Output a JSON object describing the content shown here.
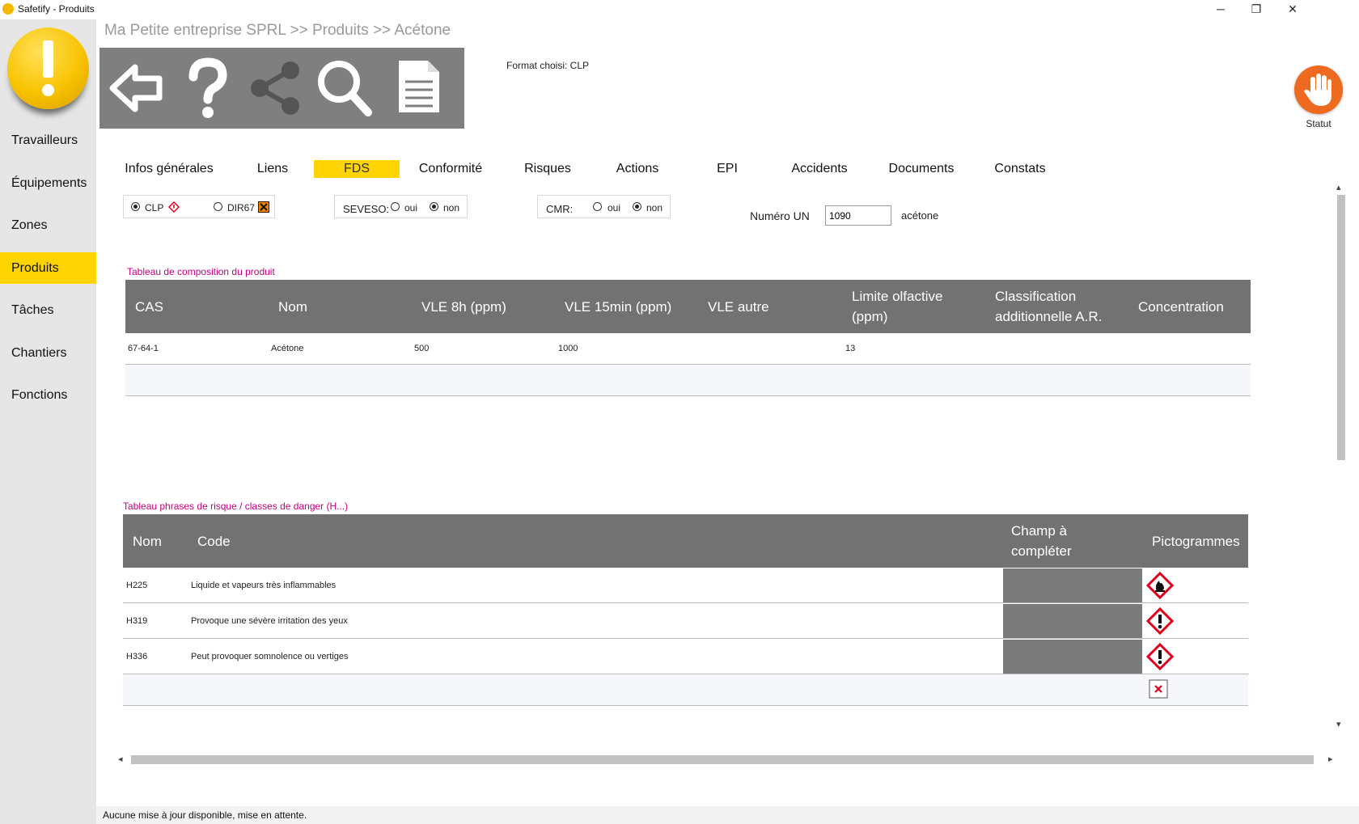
{
  "window": {
    "title": "Safetify - Produits",
    "minimize": "─",
    "maximize": "❐",
    "close": "✕"
  },
  "sidebar": {
    "items": [
      {
        "label": "Travailleurs"
      },
      {
        "label": "Équipements"
      },
      {
        "label": "Zones"
      },
      {
        "label": "Produits",
        "active": true
      },
      {
        "label": "Tâches"
      },
      {
        "label": "Chantiers"
      },
      {
        "label": "Fonctions"
      }
    ]
  },
  "breadcrumb": "Ma Petite entreprise SPRL >> Produits >> Acétone",
  "toolbar": {
    "icons": [
      "back-arrow-icon",
      "help-icon",
      "share-icon",
      "search-icon",
      "document-icon"
    ]
  },
  "format_label": "Format choisi: CLP",
  "statut_label": "Statut",
  "tabs": [
    {
      "label": "Infos générales"
    },
    {
      "label": "Liens"
    },
    {
      "label": "FDS",
      "active": true
    },
    {
      "label": "Conformité"
    },
    {
      "label": "Risques"
    },
    {
      "label": "Actions"
    },
    {
      "label": "EPI"
    },
    {
      "label": "Accidents"
    },
    {
      "label": "Documents"
    },
    {
      "label": "Constats"
    }
  ],
  "format_group": {
    "clp": "CLP",
    "dir67": "DIR67",
    "selected": "CLP"
  },
  "seveso": {
    "label": "SEVESO:",
    "oui": "oui",
    "non": "non",
    "selected": "non"
  },
  "cmr": {
    "label": "CMR:",
    "oui": "oui",
    "non": "non",
    "selected": "non"
  },
  "un": {
    "label": "Numéro UN",
    "value": "1090",
    "name": "acétone"
  },
  "composition": {
    "title": "Tableau de composition du produit",
    "headers": [
      "CAS",
      "Nom",
      "VLE 8h (ppm)",
      "VLE 15min (ppm)",
      "VLE autre",
      "Limite olfactive (ppm)",
      "Classification additionnelle A.R.",
      "Concentration"
    ],
    "rows": [
      {
        "cas": "67-64-1",
        "nom": "Acétone",
        "vle8h": "500",
        "vle15": "1000",
        "vle_autre": "",
        "limite": "13",
        "classif": "",
        "concentration": ""
      }
    ]
  },
  "hazards": {
    "title": "Tableau phrases de risque / classes de danger (H...)",
    "headers": [
      "Nom",
      "Code",
      "Champ à compléter",
      "Pictogrammes"
    ],
    "rows": [
      {
        "nom": "H225",
        "code": "Liquide et vapeurs très inflammables",
        "picto": "flame-pictogram-icon"
      },
      {
        "nom": "H319",
        "code": "Provoque une sévère irritation des yeux",
        "picto": "exclamation-pictogram-icon"
      },
      {
        "nom": "H336",
        "code": "Peut provoquer somnolence ou vertiges",
        "picto": "exclamation-pictogram-icon"
      }
    ]
  },
  "status_bar": "Aucune mise à jour disponible, mise en attente.",
  "colors": {
    "accent": "#ffd400",
    "toolbar": "#7f7f7f",
    "header": "#727272",
    "section_title": "#c4007f",
    "statut": "#ee6a1f",
    "ghs_red": "#e0001a"
  }
}
